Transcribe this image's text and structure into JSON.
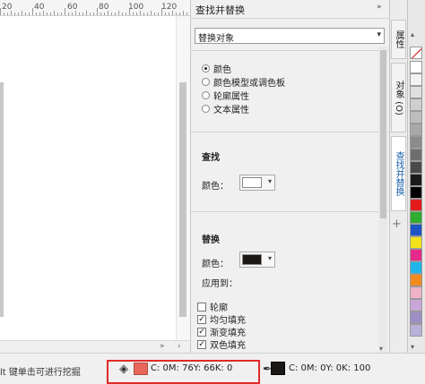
{
  "ruler": {
    "labels": [
      "20",
      "40",
      "60",
      "80",
      "100",
      "120"
    ]
  },
  "docker": {
    "title": "查找并替换",
    "collapse_icon": "double-chevron-right-icon",
    "mode_select": {
      "value": "替换对象"
    },
    "radio_options": [
      {
        "label": "颜色",
        "selected": true
      },
      {
        "label": "颜色模型或调色板",
        "selected": false
      },
      {
        "label": "轮廓属性",
        "selected": false
      },
      {
        "label": "文本属性",
        "selected": false
      }
    ],
    "find": {
      "title": "查找",
      "color_label": "颜色：",
      "color": "#ffffff"
    },
    "replace": {
      "title": "替换",
      "color_label": "颜色：",
      "color": "#1b1715",
      "apply_to_label": "应用到：",
      "checkboxes": [
        {
          "label": "轮廓",
          "checked": false
        },
        {
          "label": "均匀填充",
          "checked": true
        },
        {
          "label": "渐变填充",
          "checked": true
        },
        {
          "label": "双色填充",
          "checked": true
        }
      ]
    }
  },
  "side_tabs": [
    {
      "label": "属性",
      "active": false
    },
    {
      "label": "对象 (O)",
      "active": false
    },
    {
      "label": "查找并替换",
      "active": true
    }
  ],
  "add_tab_glyph": "+",
  "palette": {
    "colors": [
      "#ffffff",
      "#f2f2f2",
      "#e0e0e0",
      "#cfcfcf",
      "#bdbdbd",
      "#a8a8a8",
      "#8c8c8c",
      "#6e6e6e",
      "#4a4a4a",
      "#1a1a1a",
      "#000000",
      "#e21b1b",
      "#2fae2f",
      "#1d55c4",
      "#f3e21a",
      "#e62a8a",
      "#1fb5e8",
      "#f28a1d",
      "#f0b2c7",
      "#c9a6d6",
      "#9d8fc4",
      "#b8b0d8"
    ]
  },
  "statusbar": {
    "hint": "lt 键单击可进行挖掘",
    "fill": {
      "color": "#e8675a",
      "text": "C: 0M: 76Y: 66K: 0"
    },
    "outline": {
      "color": "#1b1715",
      "text": "C: 0M: 0Y: 0K: 100"
    }
  }
}
